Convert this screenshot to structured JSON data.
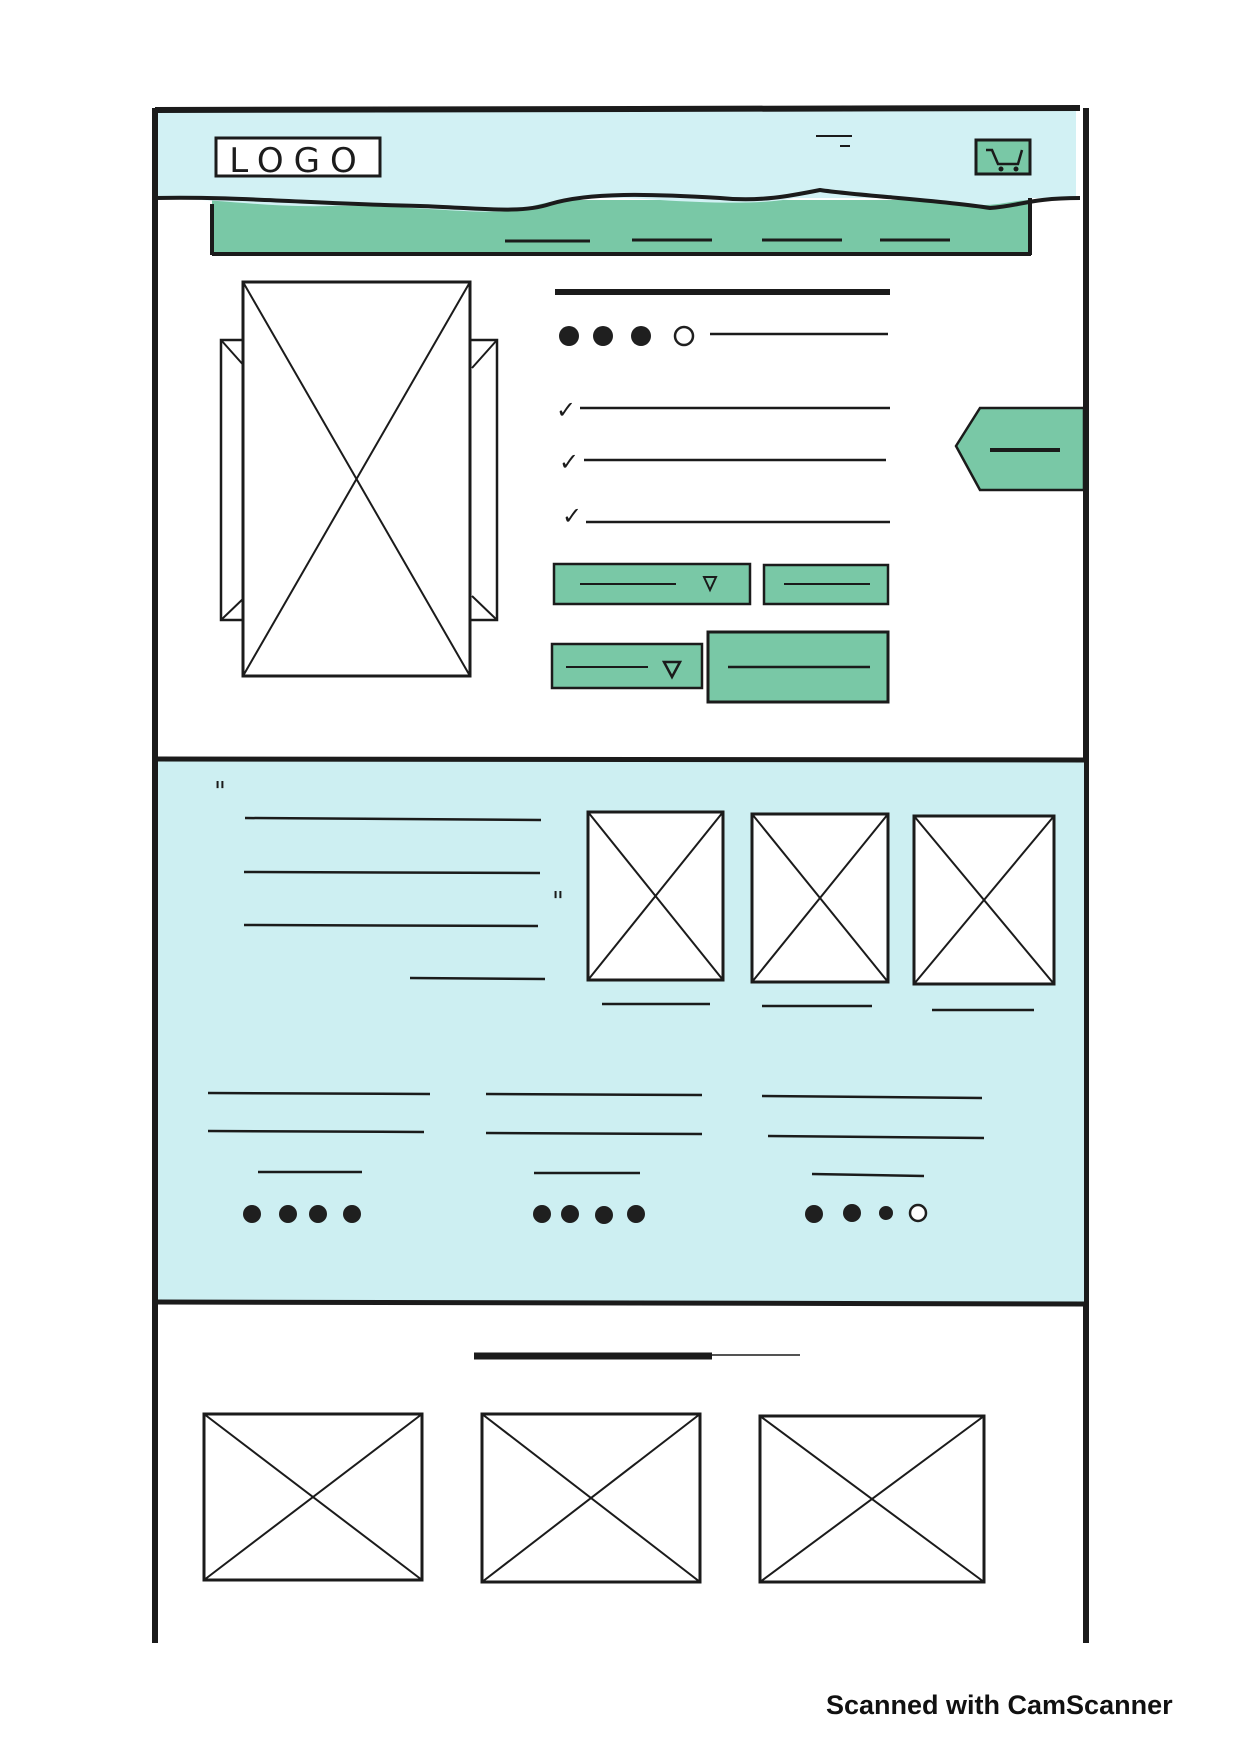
{
  "header": {
    "logo_text": "LOGO",
    "cart_icon": "cart-icon"
  },
  "colors": {
    "ink": "#1b1b1b",
    "header_fill": "#d2f1f4",
    "band_fill": "#cdeff2",
    "accent_green": "#79c8a6",
    "dot_filled": "#1f1f1f"
  },
  "product": {
    "rating_filled": 3,
    "rating_total": 4,
    "feature_checks": [
      "✓",
      "✓",
      "✓"
    ]
  },
  "testimonials": {
    "quote_mark": "\"",
    "ratings": [
      {
        "filled": 4,
        "total": 4
      },
      {
        "filled": 4,
        "total": 4
      },
      {
        "filled": 3,
        "total": 4
      }
    ]
  },
  "watermark": "Scanned with CamScanner"
}
